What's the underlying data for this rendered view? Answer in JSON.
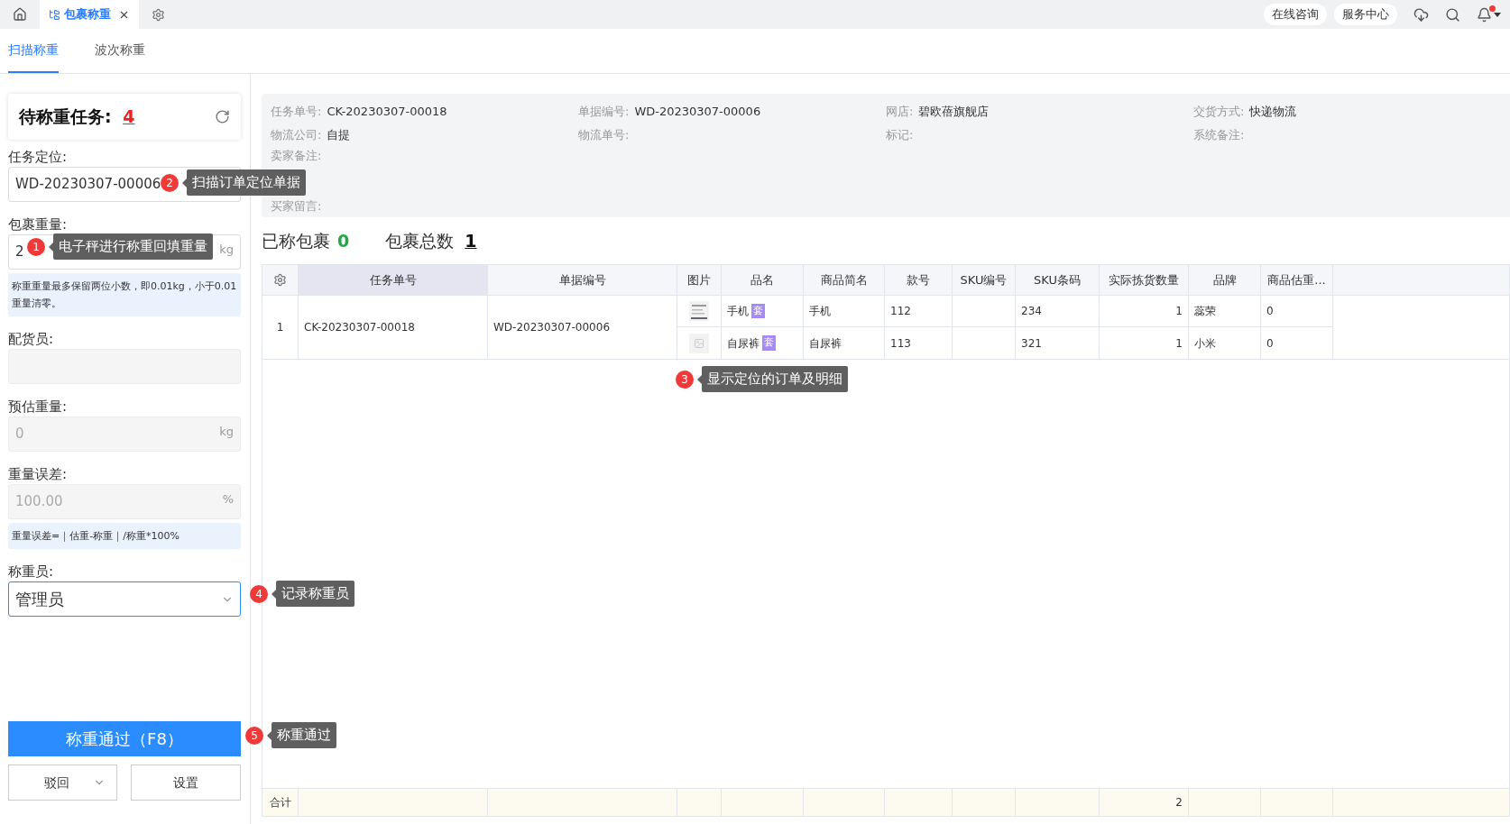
{
  "topbar": {
    "tabs": [
      {
        "label": "包裹称重",
        "selected": true
      }
    ],
    "links": [
      "在线咨询",
      "服务中心"
    ],
    "notification": true
  },
  "subtabs": [
    {
      "label": "扫描称重",
      "selected": true
    },
    {
      "label": "波次称重",
      "selected": false
    }
  ],
  "pending": {
    "label": "待称重任务:",
    "count": "4"
  },
  "form": [
    {
      "kind": "input",
      "label": "任务定位:",
      "value": "WD-20230307-00006",
      "disabled": false
    },
    {
      "kind": "input",
      "label": "包裹重量:",
      "value": "2",
      "suffix": "kg",
      "disabled": false,
      "note": "称重重量最多保留两位小数，即0.01kg，小于0.01重量清零。"
    },
    {
      "kind": "input",
      "label": "配货员:",
      "disabled": true
    },
    {
      "kind": "input",
      "label": "预估重量:",
      "value": "0",
      "suffix": "kg",
      "disabled": true
    },
    {
      "kind": "input",
      "label": "重量误差:",
      "value": "100.00",
      "suffix": "%",
      "disabled": true,
      "note": "重量误差=｜估重-称重｜/称重*100%"
    },
    {
      "kind": "select",
      "label": "称重员:",
      "value": "管理员",
      "disabled": false
    }
  ],
  "actions": {
    "primary": "称重通过（F8）",
    "reject": "驳回",
    "settings": "设置"
  },
  "info": [
    {
      "label": "任务单号:",
      "value": "CK-20230307-00018"
    },
    {
      "label": "单据编号:",
      "value": "WD-20230307-00006"
    },
    {
      "label": "网店:",
      "value": "碧欧蓓旗舰店"
    },
    {
      "label": "交货方式:",
      "value": "快递物流"
    },
    {
      "label": "物流公司:",
      "value": "自提"
    },
    {
      "label": "物流单号:"
    },
    {
      "label": "标记:"
    },
    {
      "label": "系统备注:"
    },
    {
      "label": "卖家备注:"
    },
    {
      "label": "买家留言:"
    }
  ],
  "summary": [
    {
      "label": "已称包裹",
      "value": "0",
      "kind": "done"
    },
    {
      "label": "包裹总数",
      "value": "1",
      "kind": "total"
    }
  ],
  "table": {
    "columns": [
      {
        "label": "任务单号",
        "selected": true
      },
      {
        "label": "单据编号",
        "selected": false
      },
      {
        "label": "图片",
        "selected": false
      },
      {
        "label": "品名",
        "selected": false
      },
      {
        "label": "商品简名",
        "selected": false
      },
      {
        "label": "款号",
        "selected": false
      },
      {
        "label": "SKU编号",
        "selected": false
      },
      {
        "label": "SKU条码",
        "selected": false
      },
      {
        "label": "实际拣货数量",
        "selected": false
      },
      {
        "label": "品牌",
        "selected": false
      },
      {
        "label": "商品估重..."
      }
    ],
    "rows": [
      {
        "index": "1",
        "task_no": "CK-20230307-00018",
        "doc_no": "WD-20230307-00006",
        "items": [
          {
            "kind": "thumbnail",
            "name": "手机",
            "tag": "套",
            "short_name": "手机",
            "style_no": "112",
            "sku_barcode": "234",
            "picked_qty": "1",
            "brand": "蕊荣",
            "est_weight": "0"
          },
          {
            "kind": "placeholder",
            "name": "自尿裤",
            "tag": "套",
            "short_name": "自尿裤",
            "style_no": "113",
            "sku_barcode": "321",
            "picked_qty": "1",
            "brand": "小米",
            "est_weight": "0"
          }
        ]
      }
    ],
    "footer": {
      "label": "合计",
      "picked_qty": "2"
    }
  },
  "callouts": [
    {
      "number": "1",
      "text": "电子秤进行称重回填重量"
    },
    {
      "number": "2",
      "text": "扫描订单定位单据"
    },
    {
      "number": "3",
      "text": "显示定位的订单及明细"
    },
    {
      "number": "4",
      "text": "记录称重员"
    },
    {
      "number": "5",
      "text": "称重通过"
    }
  ]
}
